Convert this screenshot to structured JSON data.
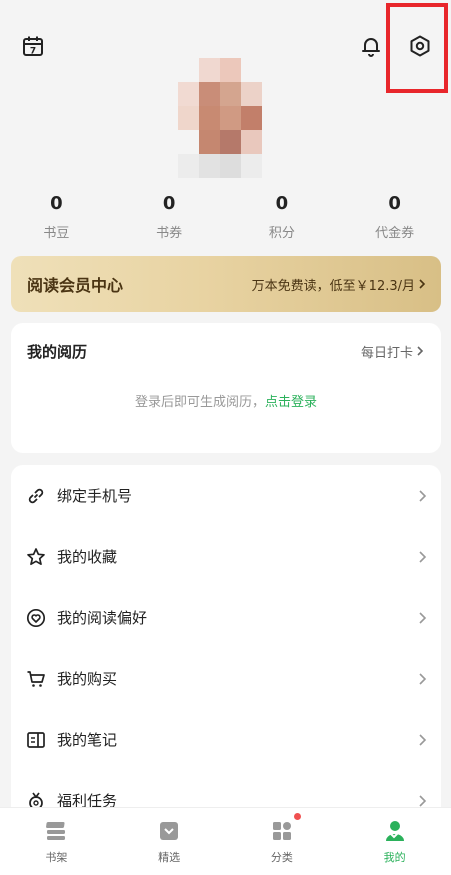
{
  "header": {
    "calendar_icon": "calendar-icon",
    "calendar_day": "7",
    "bell_icon": "bell-icon",
    "settings_icon": "settings-icon"
  },
  "stats": [
    {
      "value": "0",
      "label": "书豆"
    },
    {
      "value": "0",
      "label": "书券"
    },
    {
      "value": "0",
      "label": "积分"
    },
    {
      "value": "0",
      "label": "代金券"
    }
  ],
  "vip": {
    "title": "阅读会员中心",
    "promo": "万本免费读，低至￥12.3/月"
  },
  "history": {
    "title": "我的阅历",
    "link": "每日打卡",
    "hint": "登录后即可生成阅历，",
    "login": "点击登录"
  },
  "menu": [
    {
      "label": "绑定手机号",
      "icon": "link-icon"
    },
    {
      "label": "我的收藏",
      "icon": "star-icon"
    },
    {
      "label": "我的阅读偏好",
      "icon": "heart-icon"
    },
    {
      "label": "我的购买",
      "icon": "cart-icon"
    },
    {
      "label": "我的笔记",
      "icon": "note-icon"
    },
    {
      "label": "福利任务",
      "icon": "gift-icon"
    }
  ],
  "tabs": [
    {
      "label": "书架",
      "icon": "bookshelf-icon"
    },
    {
      "label": "精选",
      "icon": "featured-icon"
    },
    {
      "label": "分类",
      "icon": "category-icon"
    },
    {
      "label": "我的",
      "icon": "profile-icon"
    }
  ],
  "colors": {
    "accent": "#2bb15b",
    "highlight_box": "#e8262b",
    "vip_gold": "#e8d3a2"
  }
}
